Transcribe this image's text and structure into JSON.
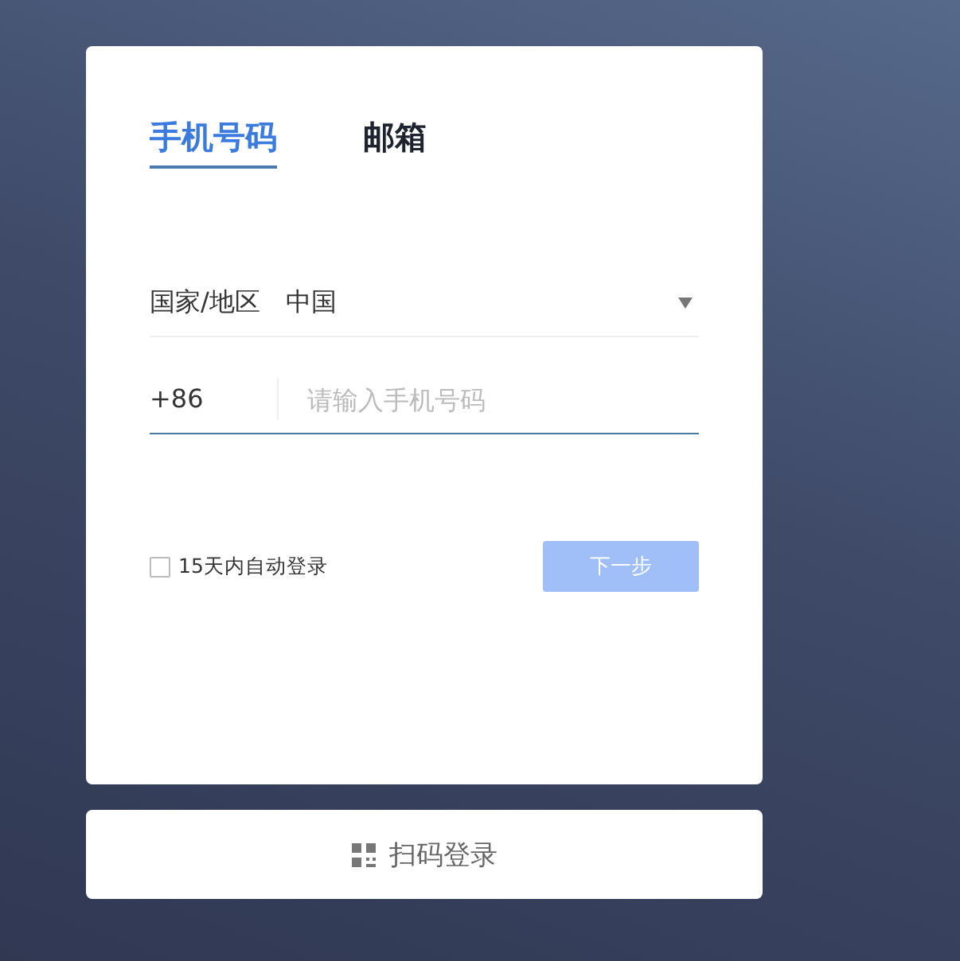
{
  "tabs": [
    {
      "label": "手机号码",
      "selected": true
    },
    {
      "label": "邮箱",
      "selected": false
    }
  ],
  "region": {
    "label": "国家/地区",
    "value": "中国"
  },
  "phone": {
    "code": "+86",
    "placeholder": "请输入手机号码"
  },
  "remember": {
    "label": "15天内自动登录",
    "checked": false
  },
  "next_button": {
    "label": "下一步",
    "disabled": true
  },
  "qr_login": {
    "label": "扫码登录"
  }
}
